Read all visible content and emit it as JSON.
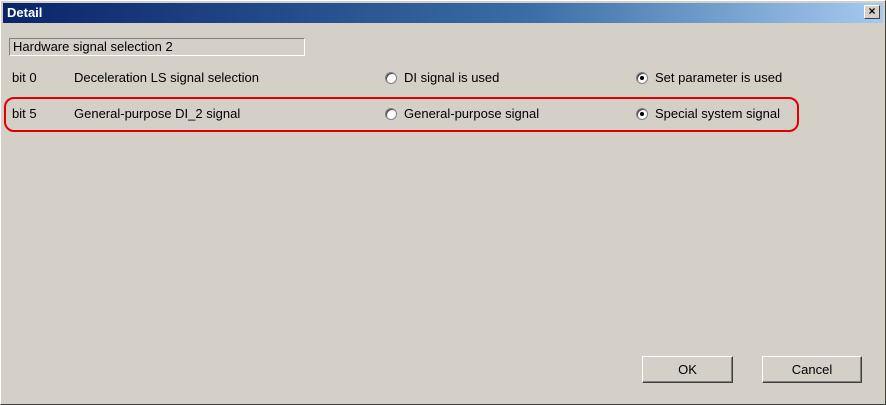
{
  "window": {
    "title": "Detail",
    "close_label": "×"
  },
  "header": {
    "field_value": "Hardware signal selection 2"
  },
  "rows": [
    {
      "bit": "bit 0",
      "description": "Deceleration LS signal selection",
      "option1": {
        "label": "DI signal is used",
        "checked": false
      },
      "option2": {
        "label": "Set parameter is used",
        "checked": true
      }
    },
    {
      "bit": "bit 5",
      "description": "General-purpose DI_2 signal",
      "option1": {
        "label": "General-purpose signal",
        "checked": false
      },
      "option2": {
        "label": "Special system signal",
        "checked": true
      }
    }
  ],
  "buttons": {
    "ok_label": "OK",
    "cancel_label": "Cancel"
  },
  "colors": {
    "titlebar_start": "#0a246a",
    "highlight": "#e00000",
    "dialog_bg": "#d4d0c8"
  }
}
